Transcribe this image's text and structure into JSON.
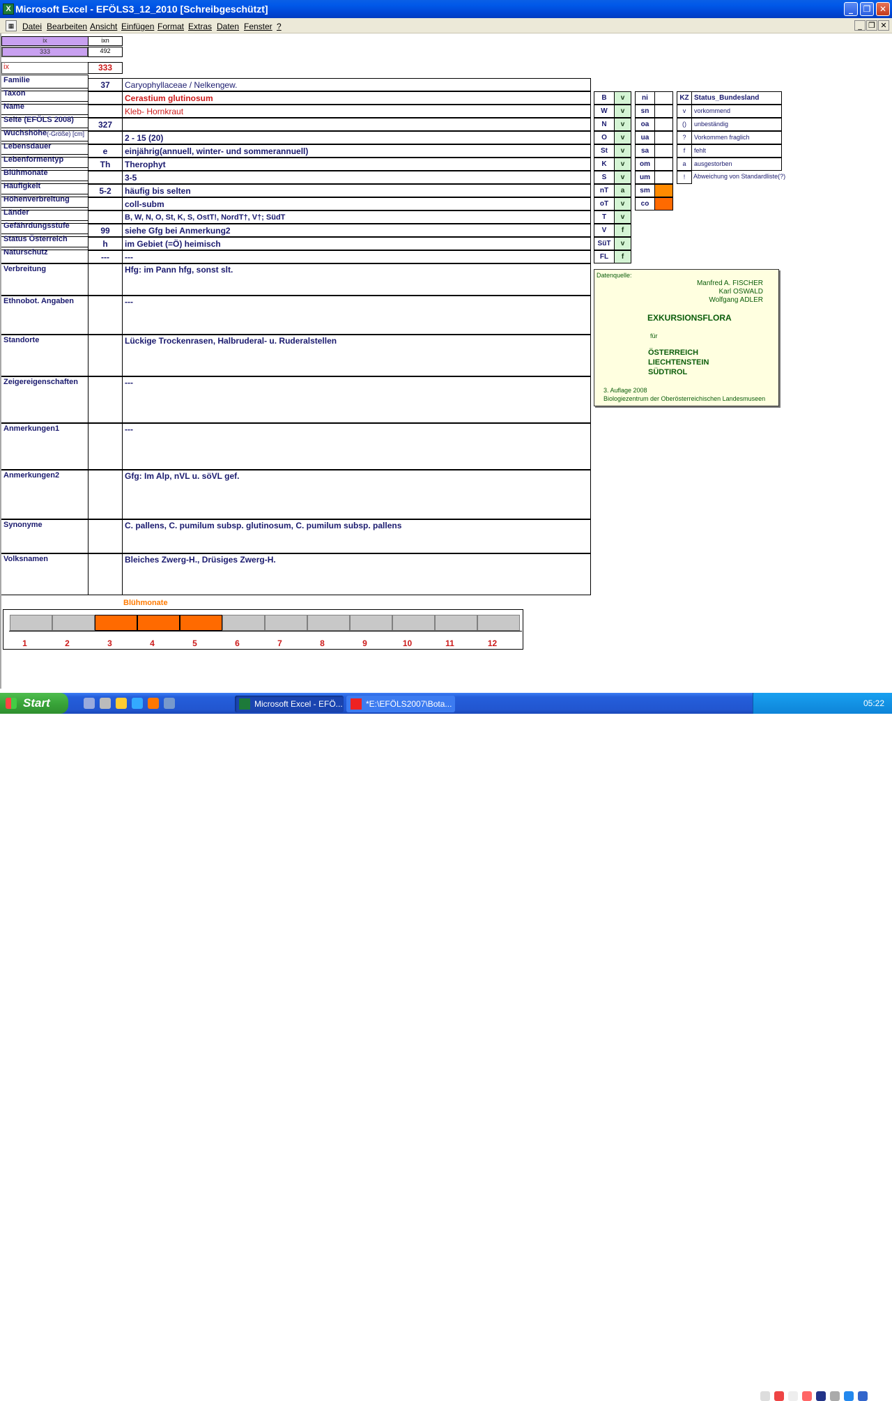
{
  "window": {
    "title": "Microsoft Excel - EFÖLS3_12_2010  [Schreibgeschützt]",
    "app_icon": "excel-icon"
  },
  "menu": [
    "Datei",
    "Bearbeiten",
    "Ansicht",
    "Einfügen",
    "Format",
    "Extras",
    "Daten",
    "Fenster",
    "?"
  ],
  "mini": {
    "h1": "ix",
    "h2": "ixn",
    "v1": "333",
    "v2": "492"
  },
  "ix": {
    "label": "ix",
    "value": "333"
  },
  "rows": [
    {
      "label": "Familie",
      "code": "37",
      "value": "Caryophyllaceae  /  Nelkengew."
    },
    {
      "label": "Taxon",
      "code": "",
      "value": "Cerastium glutinosum"
    },
    {
      "label": "Name",
      "code": "",
      "value": "Kleb- Hornkraut"
    },
    {
      "label": "Seite (EFÖLS 2008)",
      "code": "327",
      "value": ""
    },
    {
      "label": "Wuchshöhe",
      "label_extra": "(-Größe) [cm]",
      "code": "",
      "value": "2 - 15 (20)"
    },
    {
      "label": "Lebensdauer",
      "code": "e",
      "value": "einjährig(annuell, winter- und sommerannuell)"
    },
    {
      "label": "Lebenformentyp",
      "code": "Th",
      "value": "Therophyt"
    },
    {
      "label": "Blühmonate",
      "code": "",
      "value": "3-5"
    },
    {
      "label": "Häufigkeit",
      "code": "5-2",
      "value": "häufig bis selten"
    },
    {
      "label": "Höhenverbreitung",
      "code": "",
      "value": "coll-subm"
    },
    {
      "label": "Länder",
      "code": "",
      "value": "B, W, N, O, St, K, S, OstT!, NordT†, V†; SüdT"
    },
    {
      "label": "Gefährdungsstufe",
      "code": "99",
      "value": "siehe Gfg bei Anmerkung2"
    },
    {
      "label": "Status Österreich",
      "code": "h",
      "value": "im Gebiet (=Ö) heimisch"
    },
    {
      "label": "Naturschutz",
      "code": "---",
      "value": "---"
    }
  ],
  "big_rows": [
    {
      "label": "Verbreitung",
      "value": "Hfg: im Pann hfg, sonst slt."
    },
    {
      "label": "Ethnobot. Angaben",
      "value": "---"
    },
    {
      "label": "Standorte",
      "value": "Lückige Trockenrasen, Halbruderal- u. Ruderalstellen"
    },
    {
      "label": "Zeigereigenschaften",
      "value": "---"
    },
    {
      "label": "Anmerkungen1",
      "value": "---"
    },
    {
      "label": "Anmerkungen2",
      "value": "Gfg: Im Alp, nVL u. söVL gef."
    },
    {
      "label": "Synonyme",
      "value": "C. pallens, C. pumilum subsp. glutinosum, C. pumilum subsp. pallens"
    },
    {
      "label": "Volksnamen",
      "value": "Bleiches Zwerg-H., Drüsiges Zwerg-H."
    }
  ],
  "states": [
    {
      "k": "B",
      "v": "v"
    },
    {
      "k": "W",
      "v": "v"
    },
    {
      "k": "N",
      "v": "v"
    },
    {
      "k": "O",
      "v": "v"
    },
    {
      "k": "St",
      "v": "v"
    },
    {
      "k": "K",
      "v": "v"
    },
    {
      "k": "S",
      "v": "v"
    },
    {
      "k": "nT",
      "v": "a"
    },
    {
      "k": "oT",
      "v": "v"
    },
    {
      "k": "T",
      "v": "v"
    },
    {
      "k": "V",
      "v": "f"
    },
    {
      "k": "SüT",
      "v": "v"
    },
    {
      "k": "FL",
      "v": "f"
    }
  ],
  "zones": [
    {
      "k": "ni",
      "v": ""
    },
    {
      "k": "sn",
      "v": ""
    },
    {
      "k": "oa",
      "v": ""
    },
    {
      "k": "ua",
      "v": ""
    },
    {
      "k": "sa",
      "v": ""
    },
    {
      "k": "om",
      "v": ""
    },
    {
      "k": "um",
      "v": ""
    },
    {
      "k": "sm",
      "v": ""
    },
    {
      "k": "co",
      "v": ""
    }
  ],
  "legend": {
    "head_kz": "KZ",
    "head_status": "Status_Bundesland",
    "items": [
      {
        "k": "v",
        "t": "vorkommend"
      },
      {
        "k": "()",
        "t": "unbeständig"
      },
      {
        "k": "?",
        "t": "Vorkommen fraglich"
      },
      {
        "k": "f",
        "t": "fehlt"
      },
      {
        "k": "a",
        "t": "ausgestorben"
      },
      {
        "k": "!",
        "t": "Abweichung von Standardliste(?)"
      }
    ]
  },
  "source": {
    "label": "Datenquelle:",
    "authors": [
      "Manfred A. FISCHER",
      "Karl OSWALD",
      "Wolfgang ADLER"
    ],
    "title": "EXKURSIONSFLORA",
    "fuer": "für",
    "countries": [
      "ÖSTERREICH",
      "LIECHTENSTEIN",
      "SÜDTIROL"
    ],
    "edition": "3. Auflage 2008",
    "publisher": "Biologiezentrum der Oberösterreichischen Landesmuseen"
  },
  "bloom": {
    "title": "Blühmonate",
    "months": [
      "1",
      "2",
      "3",
      "4",
      "5",
      "6",
      "7",
      "8",
      "9",
      "10",
      "11",
      "12"
    ],
    "active": [
      false,
      false,
      true,
      true,
      true,
      false,
      false,
      false,
      false,
      false,
      false,
      false
    ],
    "active_color": "#ff6a00",
    "inactive_color": "#c8c8c8"
  },
  "taskbar": {
    "start": "Start",
    "tasks": [
      "Microsoft Excel - EFÖ...",
      "*E:\\EFÖLS2007\\Bota..."
    ],
    "clock": "05:22"
  }
}
